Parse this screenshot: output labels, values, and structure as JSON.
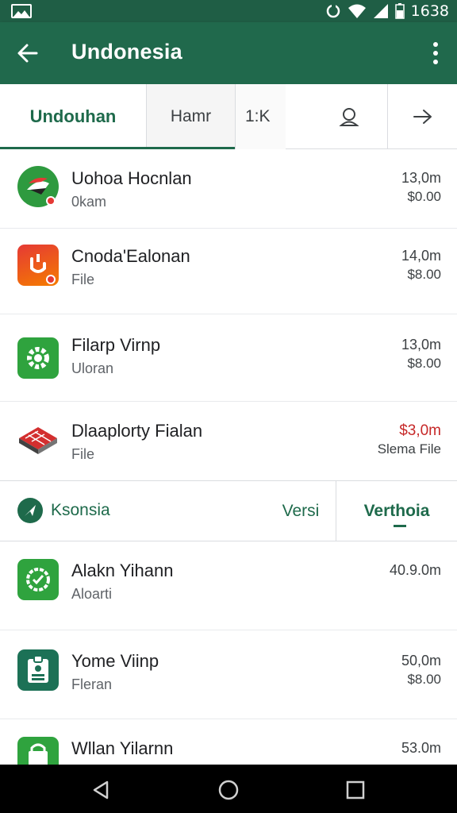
{
  "status_bar": {
    "time": "1638",
    "icons": [
      "image-icon",
      "sync-icon",
      "wifi-icon",
      "signal-icon",
      "battery-icon"
    ]
  },
  "app_bar": {
    "title": "Undonesia",
    "back_icon": "arrow-left-icon",
    "menu_icon": "more-vert-icon"
  },
  "tabs": [
    {
      "label": "Undouhan",
      "selected": true
    },
    {
      "label": "Hamr"
    },
    {
      "label": "1:K"
    },
    {
      "icon": "person-icon"
    },
    {
      "icon": "arrow-right-icon"
    }
  ],
  "apps_top": [
    {
      "title": "Uohoa Hocnlan",
      "subtitle": "0kam",
      "size": "13,0m",
      "price": "$0.00",
      "icon": "flame-app-icon"
    },
    {
      "title": "Cnoda'Ealonan",
      "subtitle": "File",
      "size": "14,0m",
      "price": "$8.00",
      "icon": "red-orange-app-icon"
    },
    {
      "title": "Filarp Virnp",
      "subtitle": "Uloran",
      "size": "13,0m",
      "price": "$8.00",
      "icon": "gear-app-icon"
    },
    {
      "title": "Dlaaplorty Fialan",
      "subtitle": "File",
      "size": "$3,0m",
      "price": "Slema File",
      "icon": "cube-app-icon",
      "highlight": "red"
    }
  ],
  "section": {
    "label": "Ksonsia",
    "button_1": "Versi",
    "button_2": "Verthoia",
    "icon": "send-icon"
  },
  "apps_bottom": [
    {
      "title": "Alakn Yihann",
      "subtitle": "Aloarti",
      "size": "40.9.0m",
      "price": "",
      "icon": "shield-app-icon"
    },
    {
      "title": "Yome Viinp",
      "subtitle": "Fleran",
      "size": "50,0m",
      "price": "$8.00",
      "icon": "badge-app-icon"
    },
    {
      "title": "Wllan Yilarnn",
      "subtitle": "",
      "size": "53.0m",
      "price": "",
      "icon": "bag-app-icon"
    }
  ],
  "nav_bar": {
    "icons": [
      "back-triangle-icon",
      "home-circle-icon",
      "recents-square-icon"
    ]
  },
  "colors": {
    "primary": "#20694c",
    "status_bar": "#1f5e45",
    "accent": "#1e6a4b",
    "warning": "#c62828"
  }
}
